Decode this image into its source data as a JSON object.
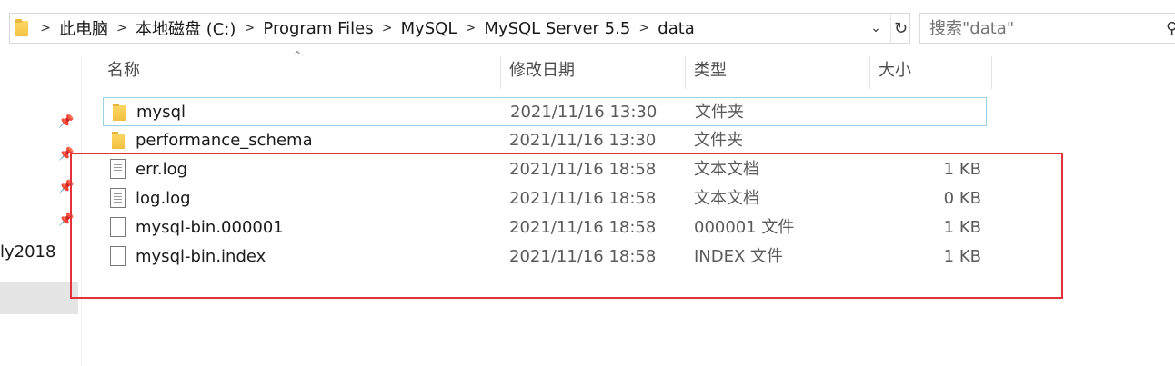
{
  "address_bar": {
    "breadcrumbs": [
      "此电脑",
      "本地磁盘 (C:)",
      "Program Files",
      "MySQL",
      "MySQL Server 5.5",
      "data"
    ],
    "separator_icon": "chevron-right-icon"
  },
  "search": {
    "placeholder": "搜索\"data\""
  },
  "nav": {
    "partial_label": "ly2018"
  },
  "columns": {
    "name": "名称",
    "date": "修改日期",
    "type": "类型",
    "size": "大小"
  },
  "files": [
    {
      "name": "mysql",
      "date": "2021/11/16 13:30",
      "type": "文件夹",
      "size": "",
      "icon": "folder-icon"
    },
    {
      "name": "performance_schema",
      "date": "2021/11/16 13:30",
      "type": "文件夹",
      "size": "",
      "icon": "folder-icon"
    },
    {
      "name": "err.log",
      "date": "2021/11/16 18:58",
      "type": "文本文档",
      "size": "1 KB",
      "icon": "text-document-icon"
    },
    {
      "name": "log.log",
      "date": "2021/11/16 18:58",
      "type": "文本文档",
      "size": "0 KB",
      "icon": "text-document-icon"
    },
    {
      "name": "mysql-bin.000001",
      "date": "2021/11/16 18:58",
      "type": "000001 文件",
      "size": "1 KB",
      "icon": "file-icon"
    },
    {
      "name": "mysql-bin.index",
      "date": "2021/11/16 18:58",
      "type": "INDEX 文件",
      "size": "1 KB",
      "icon": "file-icon"
    }
  ],
  "colors": {
    "highlight": "#e0333a",
    "selection_border": "#99d1e4",
    "folder": "#f3c443"
  }
}
